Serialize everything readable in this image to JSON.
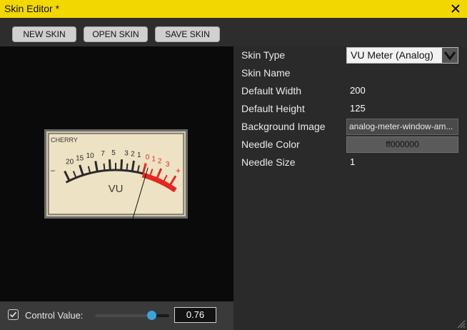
{
  "window": {
    "title": "Skin Editor *"
  },
  "toolbar": {
    "new_skin": "NEW SKIN",
    "open_skin": "OPEN SKIN",
    "save_skin": "SAVE SKIN"
  },
  "preview": {
    "meter": {
      "brand": "CHERRY",
      "unit": "VU",
      "scale_labels": [
        "20",
        "15",
        "10",
        "7",
        "5",
        "3",
        "2",
        "1",
        "0",
        "1",
        "2",
        "3"
      ],
      "minus": "–",
      "plus": "+",
      "needle_value": 0.76,
      "colors": {
        "face": "#ede3c4",
        "ink": "#2a2a2a",
        "red": "#e52620",
        "frame": "#6a6a6a"
      }
    }
  },
  "control": {
    "label": "Control Value:",
    "value": "0.76",
    "slider_fraction": 0.76,
    "checked": true
  },
  "properties": [
    {
      "name": "Skin Type",
      "value": "VU Meter (Analog)",
      "kind": "dropdown"
    },
    {
      "name": "Skin Name",
      "value": "",
      "kind": "text"
    },
    {
      "name": "Default Width",
      "value": "200",
      "kind": "text"
    },
    {
      "name": "Default Height",
      "value": "125",
      "kind": "text"
    },
    {
      "name": "Background Image",
      "value": "analog-meter-window-am...",
      "kind": "box"
    },
    {
      "name": "Needle Color",
      "value": "ff000000",
      "kind": "color"
    },
    {
      "name": "Needle Size",
      "value": "1",
      "kind": "text"
    }
  ],
  "colors": {
    "title_bar": "#f3d800",
    "accent": "#3aa3d8"
  },
  "icons": {
    "close": "close-icon",
    "check": "check-icon",
    "dropdown": "chevron-down-icon",
    "resize": "resize-grip-icon"
  }
}
